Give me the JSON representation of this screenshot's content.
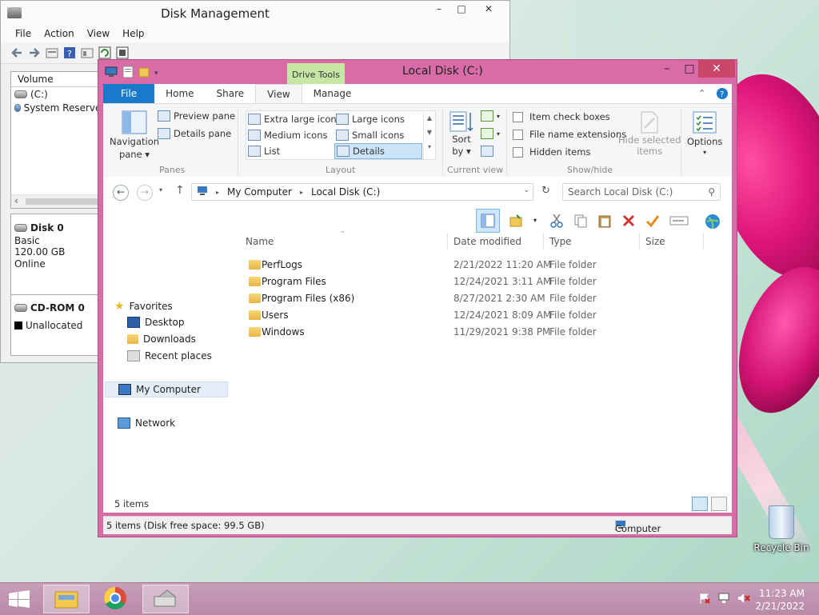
{
  "disk_mgmt": {
    "title": "Disk Management",
    "menu": [
      "File",
      "Action",
      "View",
      "Help"
    ],
    "volume_header": "Volume",
    "volumes": [
      "(C:)",
      "System Reserved"
    ],
    "disks": [
      {
        "name": "Disk 0",
        "type": "Basic",
        "size": "120.00 GB",
        "status": "Online"
      },
      {
        "name": "CD-ROM 0",
        "legend": "Unallocated"
      }
    ]
  },
  "explorer": {
    "title": "Local Disk (C:)",
    "contextual_tab": "Drive Tools",
    "tabs": [
      "File",
      "Home",
      "Share",
      "View",
      "Manage"
    ],
    "ribbon": {
      "panes": {
        "nav_line1": "Navigation",
        "nav_line2": "pane",
        "preview": "Preview pane",
        "details": "Details pane",
        "label": "Panes"
      },
      "layout": {
        "xl": "Extra large icons",
        "large": "Large icons",
        "medium": "Medium icons",
        "small": "Small icons",
        "list": "List",
        "details": "Details",
        "label": "Layout"
      },
      "current_view": {
        "sort_line1": "Sort",
        "sort_line2": "by",
        "label": "Current view"
      },
      "show_hide": {
        "item_check": "Item check boxes",
        "ext": "File name extensions",
        "hidden": "Hidden items",
        "hide_line1": "Hide selected",
        "hide_line2": "items",
        "label": "Show/hide"
      },
      "options": "Options"
    },
    "address": {
      "root": "My Computer",
      "current": "Local Disk (C:)",
      "search_placeholder": "Search Local Disk (C:)"
    },
    "nav": {
      "favorites": "Favorites",
      "desktop": "Desktop",
      "downloads": "Downloads",
      "recent": "Recent places",
      "computer": "My Computer",
      "network": "Network"
    },
    "columns": {
      "name": "Name",
      "date": "Date modified",
      "type": "Type",
      "size": "Size"
    },
    "files": [
      {
        "name": "PerfLogs",
        "date": "2/21/2022 11:20 AM",
        "type": "File folder"
      },
      {
        "name": "Program Files",
        "date": "12/24/2021 3:11 AM",
        "type": "File folder"
      },
      {
        "name": "Program Files (x86)",
        "date": "8/27/2021 2:30 AM",
        "type": "File folder"
      },
      {
        "name": "Users",
        "date": "12/24/2021 8:09 AM",
        "type": "File folder"
      },
      {
        "name": "Windows",
        "date": "11/29/2021 9:38 PM",
        "type": "File folder"
      }
    ],
    "item_count": "5 items",
    "status_left": "5 items (Disk free space: 99.5 GB)",
    "status_right": "Computer"
  },
  "desktop": {
    "recycle_bin": "Recycle Bin"
  },
  "taskbar": {
    "time": "11:23 AM",
    "date": "2/21/2022"
  }
}
